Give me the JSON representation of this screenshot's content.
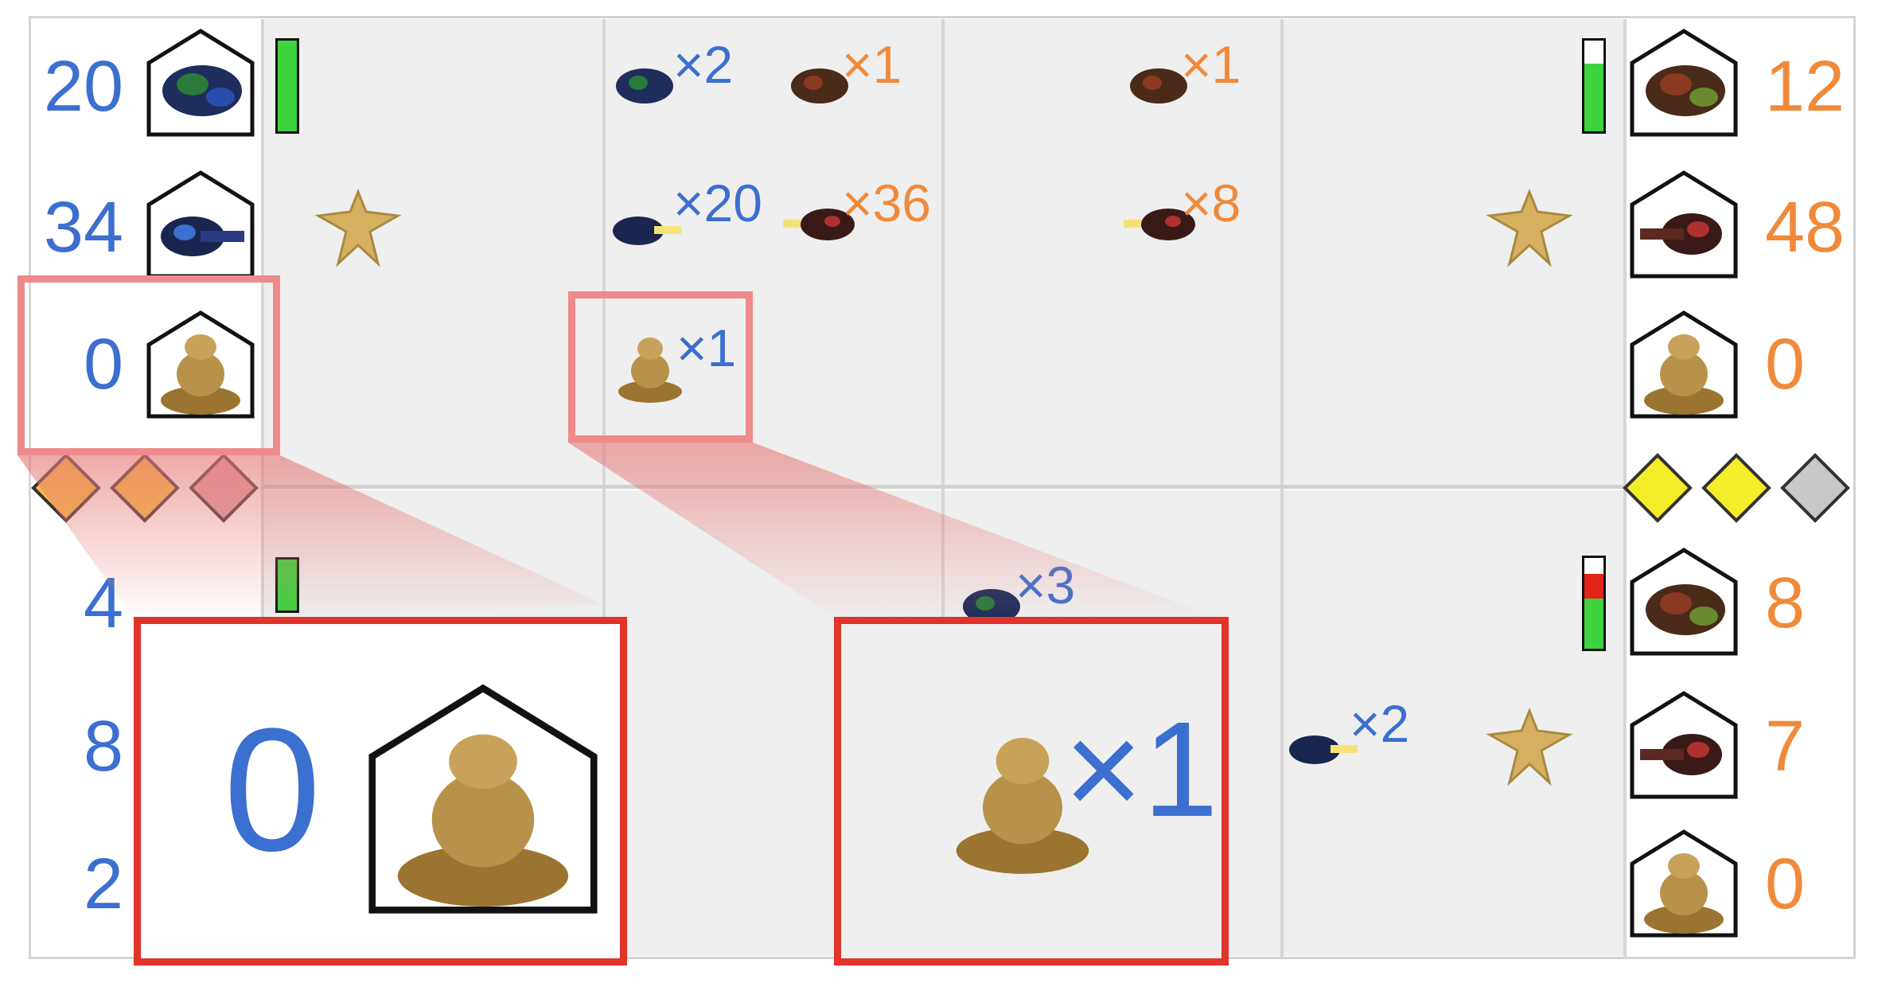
{
  "left_player": {
    "color": "#3b6fd0",
    "counts": [
      "20",
      "34",
      "0",
      "4",
      "8",
      "2"
    ],
    "buildings": [
      "bug-hive-building-icon",
      "tank-factory-building-icon",
      "sandstone-golem-building-icon"
    ],
    "diamonds": [
      "#f7bd3f",
      "#f7bd3f",
      "#dfa0a0"
    ]
  },
  "right_player": {
    "color": "#f08a3a",
    "counts": [
      "12",
      "48",
      "0",
      "8",
      "7",
      "0"
    ],
    "buildings": [
      "bug-hive-building-icon",
      "tank-factory-building-icon",
      "sandstone-golem-building-icon"
    ],
    "diamonds": [
      "#f5ed2a",
      "#f5ed2a",
      "#c8c8c8"
    ]
  },
  "health_bars": {
    "top_left": 1.0,
    "top_right": 0.75,
    "bottom_left": 1.0,
    "bottom_right": 0.55
  },
  "units": {
    "top_mid_left": {
      "blue_bug": "×2",
      "orange_bug": "×1",
      "blue_tank": "×20",
      "orange_tank": "×36",
      "blue_golem": "×1"
    },
    "top_mid_right": {
      "orange_bug": "×1",
      "orange_tank": "×8"
    },
    "bottom_mid_right": {
      "blue_bug": "×3"
    },
    "bottom_right_lane": {
      "blue_tank": "×2"
    }
  },
  "zoom": {
    "left_value": "0",
    "right_value": "×1"
  }
}
